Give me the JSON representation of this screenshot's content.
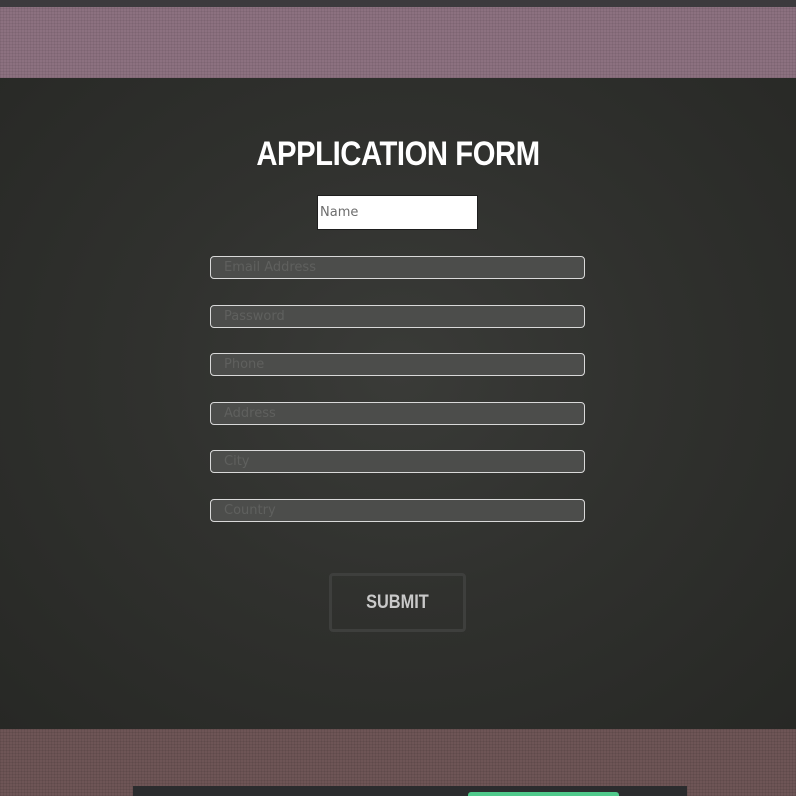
{
  "form": {
    "title": "APPLICATION FORM",
    "name_placeholder": "Name",
    "email_placeholder": "Email Address",
    "password_placeholder": "Password",
    "phone_placeholder": "Phone",
    "address_placeholder": "Address",
    "city_placeholder": "City",
    "country_placeholder": "Country",
    "submit_label": "SUBMIT"
  },
  "colors": {
    "top_band": "#8c7180",
    "form_background": "#30312e",
    "bottom_band": "#6e5556",
    "footer_accent": "#4fc98b"
  }
}
